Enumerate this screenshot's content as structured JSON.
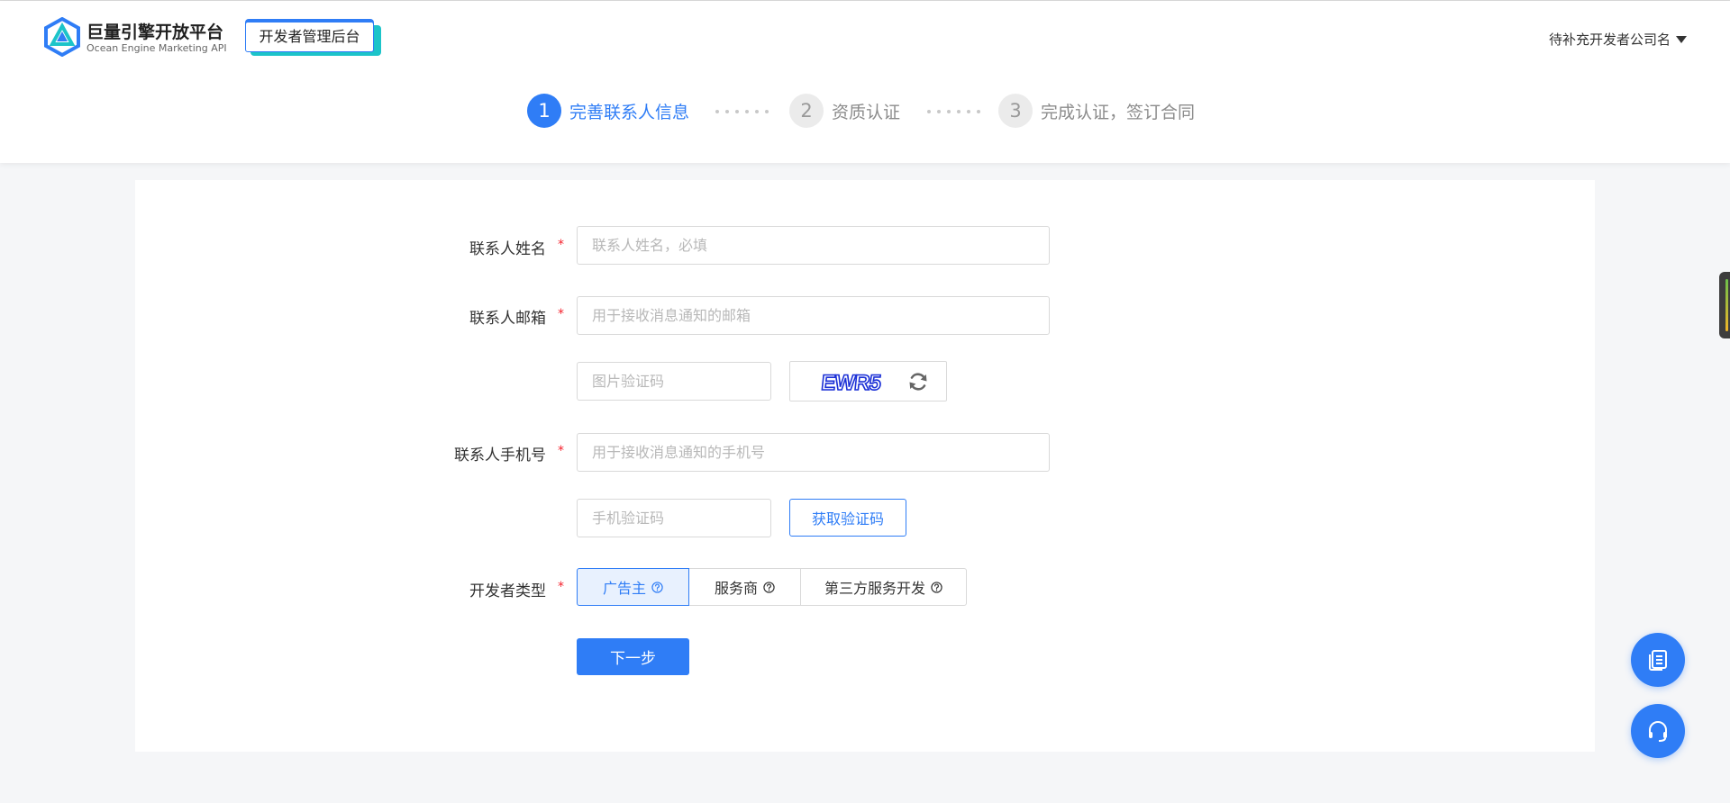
{
  "brand": {
    "title": "巨量引擎开放平台",
    "subtitle": "Ocean Engine Marketing API",
    "badge": "开发者管理后台"
  },
  "header": {
    "company_name": "待补充开发者公司名"
  },
  "steps": [
    {
      "num": "1",
      "label": "完善联系人信息",
      "state": "active"
    },
    {
      "num": "2",
      "label": "资质认证",
      "state": "inactive"
    },
    {
      "num": "3",
      "label": "完成认证，签订合同",
      "state": "inactive"
    }
  ],
  "form": {
    "name": {
      "label": "联系人姓名",
      "placeholder": "联系人姓名，必填",
      "value": ""
    },
    "email": {
      "label": "联系人邮箱",
      "placeholder": "用于接收消息通知的邮箱",
      "value": ""
    },
    "image_code": {
      "placeholder": "图片验证码",
      "value": "",
      "captcha_text": "EWR5"
    },
    "phone": {
      "label": "联系人手机号",
      "placeholder": "用于接收消息通知的手机号",
      "value": ""
    },
    "sms_code": {
      "placeholder": "手机验证码",
      "value": "",
      "button": "获取验证码"
    },
    "dev_type": {
      "label": "开发者类型",
      "options": [
        "广告主",
        "服务商",
        "第三方服务开发"
      ],
      "selected": "广告主"
    },
    "required_mark": "*",
    "next_button": "下一步"
  },
  "colors": {
    "primary": "#2f7df6",
    "teal": "#1cc4c9",
    "required": "#f5222d",
    "background": "#f5f6f8"
  },
  "icons": {
    "logo": "ocean-engine-logo",
    "refresh": "refresh-icon",
    "help": "question-circle-icon",
    "doc": "document-icon",
    "support": "headset-icon"
  }
}
